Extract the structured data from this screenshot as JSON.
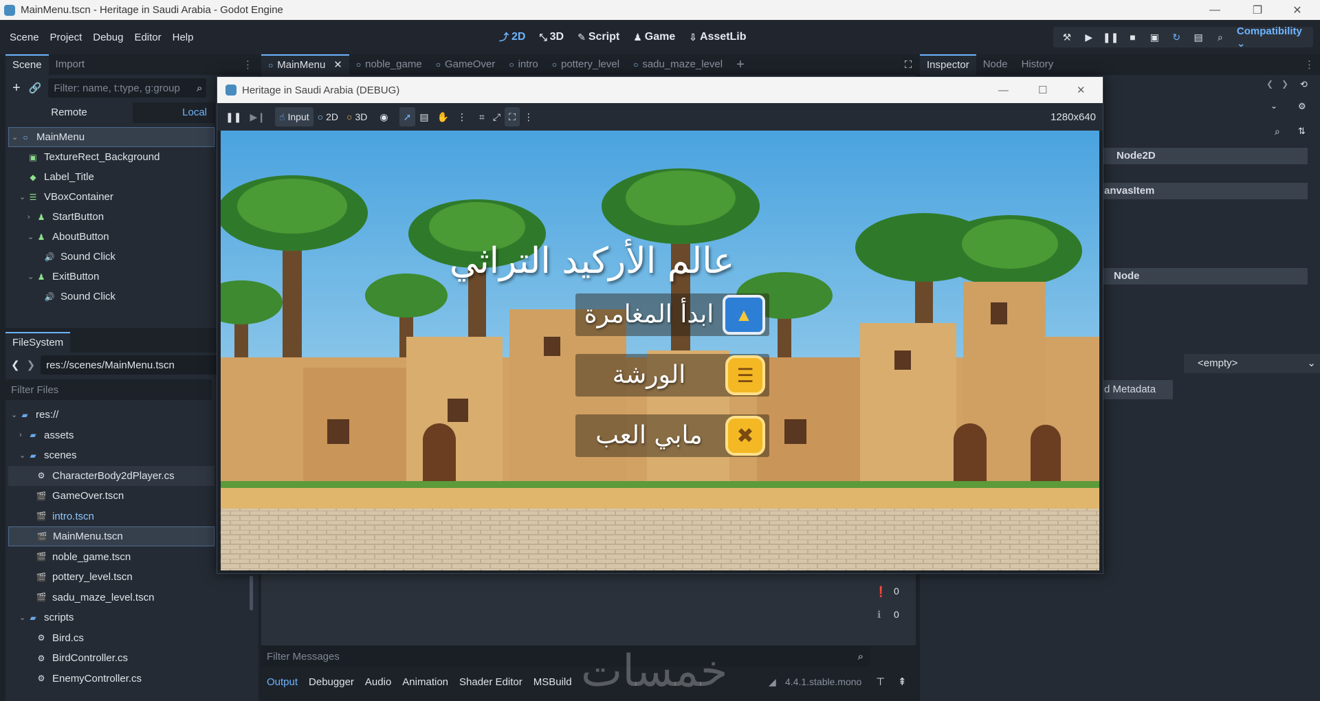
{
  "window": {
    "title": "MainMenu.tscn - Heritage in Saudi Arabia - Godot Engine"
  },
  "menubar": {
    "items": [
      "Scene",
      "Project",
      "Debug",
      "Editor",
      "Help"
    ],
    "workspaces": [
      {
        "label": "2D",
        "icon": "2d-icon",
        "active": true
      },
      {
        "label": "3D",
        "icon": "3d-icon",
        "active": false
      },
      {
        "label": "Script",
        "icon": "script-icon",
        "active": false
      },
      {
        "label": "Game",
        "icon": "game-icon",
        "active": false
      },
      {
        "label": "AssetLib",
        "icon": "assetlib-icon",
        "active": false
      }
    ],
    "renderer": "Compatibility"
  },
  "scene_dock": {
    "tabs": [
      "Scene",
      "Import"
    ],
    "filter_placeholder": "Filter: name, t:type, g:group",
    "remote_label": "Remote",
    "local_label": "Local",
    "tree": [
      {
        "label": "MainMenu",
        "depth": 0,
        "icon": "node-icon",
        "selected": true,
        "arrow": "v"
      },
      {
        "label": "TextureRect_Background",
        "depth": 1,
        "icon": "texture-rect-icon",
        "arrow": ""
      },
      {
        "label": "Label_Title",
        "depth": 1,
        "icon": "label-icon",
        "arrow": ""
      },
      {
        "label": "VBoxContainer",
        "depth": 1,
        "icon": "vbox-icon",
        "arrow": "v"
      },
      {
        "label": "StartButton",
        "depth": 2,
        "icon": "button-icon",
        "arrow": ">"
      },
      {
        "label": "AboutButton",
        "depth": 2,
        "icon": "button-icon",
        "arrow": "v"
      },
      {
        "label": "Sound Click",
        "depth": 3,
        "icon": "audio-icon",
        "arrow": ""
      },
      {
        "label": "ExitButton",
        "depth": 2,
        "icon": "button-icon",
        "arrow": "v"
      },
      {
        "label": "Sound Click",
        "depth": 3,
        "icon": "audio-icon",
        "arrow": ""
      }
    ]
  },
  "filesystem": {
    "tab": "FileSystem",
    "path": "res://scenes/MainMenu.tscn",
    "filter_placeholder": "Filter Files",
    "items": [
      {
        "label": "res://",
        "depth": 0,
        "type": "folder",
        "arrow": "v"
      },
      {
        "label": "assets",
        "depth": 1,
        "type": "folder",
        "arrow": ">"
      },
      {
        "label": "scenes",
        "depth": 1,
        "type": "folder",
        "arrow": "v"
      },
      {
        "label": "CharacterBody2dPlayer.cs",
        "depth": 2,
        "type": "cs",
        "highlight": true
      },
      {
        "label": "GameOver.tscn",
        "depth": 2,
        "type": "scene"
      },
      {
        "label": "intro.tscn",
        "depth": 2,
        "type": "scene",
        "link": true
      },
      {
        "label": "MainMenu.tscn",
        "depth": 2,
        "type": "scene",
        "selected": true
      },
      {
        "label": "noble_game.tscn",
        "depth": 2,
        "type": "scene"
      },
      {
        "label": "pottery_level.tscn",
        "depth": 2,
        "type": "scene"
      },
      {
        "label": "sadu_maze_level.tscn",
        "depth": 2,
        "type": "scene"
      },
      {
        "label": "scripts",
        "depth": 1,
        "type": "folder",
        "arrow": "v"
      },
      {
        "label": "Bird.cs",
        "depth": 2,
        "type": "cs"
      },
      {
        "label": "BirdController.cs",
        "depth": 2,
        "type": "cs"
      },
      {
        "label": "EnemyController.cs",
        "depth": 2,
        "type": "cs"
      }
    ]
  },
  "scene_tabs": [
    "MainMenu",
    "noble_game",
    "GameOver",
    "intro",
    "pottery_level",
    "sadu_maze_level"
  ],
  "inspector": {
    "tabs": [
      "Inspector",
      "Node",
      "History"
    ],
    "sections": [
      "Node2D",
      "anvasItem",
      "Node"
    ],
    "empty_value": "<empty>",
    "metadata_label": "d Metadata"
  },
  "game_window": {
    "title": "Heritage in Saudi Arabia (DEBUG)",
    "toolbar": {
      "input": "Input",
      "mode2d": "2D",
      "mode3d": "3D"
    },
    "resolution": "1280x640",
    "game_title": "عالم الأركيد التراثي",
    "buttons": [
      {
        "label": "ابدأ المغامرة",
        "icon": "triangle-icon"
      },
      {
        "label": "الورشة",
        "icon": "list-icon"
      },
      {
        "label": "مابي العب",
        "icon": "x-icon"
      }
    ]
  },
  "bottom_panel": {
    "filter_placeholder": "Filter Messages",
    "tabs": [
      "Output",
      "Debugger",
      "Audio",
      "Animation",
      "Shader Editor",
      "MSBuild"
    ],
    "active_tab": "Output",
    "version": "4.4.1.stable.mono",
    "warning_count": "0",
    "info_count": "0"
  },
  "watermark": "خمسات",
  "colors": {
    "accent": "#6db5ff",
    "panel": "#252b34",
    "bg": "#1d2229"
  }
}
